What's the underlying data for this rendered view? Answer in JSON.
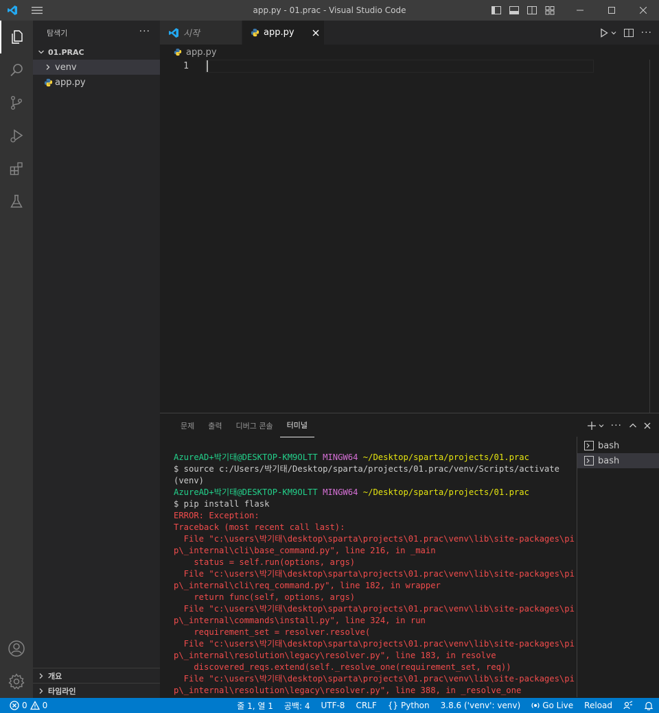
{
  "window": {
    "title": "app.py - 01.prac - Visual Studio Code"
  },
  "sidebar": {
    "header": "탐색기",
    "more": "···",
    "root_folder": "01.PRAC",
    "items": [
      {
        "label": "venv",
        "type": "folder"
      },
      {
        "label": "app.py",
        "type": "file"
      }
    ],
    "sections": [
      "개요",
      "타임라인"
    ]
  },
  "editor": {
    "tabs": [
      {
        "label": "시작",
        "active": false
      },
      {
        "label": "app.py",
        "active": true
      }
    ],
    "breadcrumb": "app.py",
    "line_number": "1"
  },
  "panel": {
    "tabs": [
      "문제",
      "출력",
      "디버그 콘솔",
      "터미널"
    ],
    "active_tab": "터미널",
    "terminals": [
      "bash",
      "bash"
    ],
    "lines": [
      [
        {
          "c": "t-green",
          "t": "AzureAD+박기태@DESKTOP-KM9OLTT "
        },
        {
          "c": "t-magenta",
          "t": "MINGW64 "
        },
        {
          "c": "t-yellow",
          "t": "~/Desktop/sparta/projects/01.prac"
        }
      ],
      [
        {
          "c": "t-white",
          "t": "$ source c:/Users/박기태/Desktop/sparta/projects/01.prac/venv/Scripts/activate"
        }
      ],
      [
        {
          "c": "t-white",
          "t": "(venv)"
        }
      ],
      [
        {
          "c": "t-green",
          "t": "AzureAD+박기태@DESKTOP-KM9OLTT "
        },
        {
          "c": "t-magenta",
          "t": "MINGW64 "
        },
        {
          "c": "t-yellow",
          "t": "~/Desktop/sparta/projects/01.prac"
        }
      ],
      [
        {
          "c": "t-white",
          "t": "$ pip install flask"
        }
      ],
      [
        {
          "c": "t-red",
          "t": "ERROR: Exception:"
        }
      ],
      [
        {
          "c": "t-red",
          "t": "Traceback (most recent call last):"
        }
      ],
      [
        {
          "c": "t-red",
          "t": "  File \"c:\\users\\박기태\\desktop\\sparta\\projects\\01.prac\\venv\\lib\\site-packages\\pi"
        }
      ],
      [
        {
          "c": "t-red",
          "t": "p\\_internal\\cli\\base_command.py\", line 216, in _main"
        }
      ],
      [
        {
          "c": "t-red",
          "t": "    status = self.run(options, args)"
        }
      ],
      [
        {
          "c": "t-red",
          "t": "  File \"c:\\users\\박기태\\desktop\\sparta\\projects\\01.prac\\venv\\lib\\site-packages\\pi"
        }
      ],
      [
        {
          "c": "t-red",
          "t": "p\\_internal\\cli\\req_command.py\", line 182, in wrapper"
        }
      ],
      [
        {
          "c": "t-red",
          "t": "    return func(self, options, args)"
        }
      ],
      [
        {
          "c": "t-red",
          "t": "  File \"c:\\users\\박기태\\desktop\\sparta\\projects\\01.prac\\venv\\lib\\site-packages\\pi"
        }
      ],
      [
        {
          "c": "t-red",
          "t": "p\\_internal\\commands\\install.py\", line 324, in run"
        }
      ],
      [
        {
          "c": "t-red",
          "t": "    requirement_set = resolver.resolve("
        }
      ],
      [
        {
          "c": "t-red",
          "t": "  File \"c:\\users\\박기태\\desktop\\sparta\\projects\\01.prac\\venv\\lib\\site-packages\\pi"
        }
      ],
      [
        {
          "c": "t-red",
          "t": "p\\_internal\\resolution\\legacy\\resolver.py\", line 183, in resolve"
        }
      ],
      [
        {
          "c": "t-red",
          "t": "    discovered_reqs.extend(self._resolve_one(requirement_set, req))"
        }
      ],
      [
        {
          "c": "t-red",
          "t": "  File \"c:\\users\\박기태\\desktop\\sparta\\projects\\01.prac\\venv\\lib\\site-packages\\pi"
        }
      ],
      [
        {
          "c": "t-red",
          "t": "p\\_internal\\resolution\\legacy\\resolver.py\", line 388, in _resolve_one"
        }
      ]
    ]
  },
  "statusbar": {
    "errors": "0",
    "warnings": "0",
    "position": "줄 1, 열 1",
    "spaces": "공백: 4",
    "encoding": "UTF-8",
    "eol": "CRLF",
    "language": "Python",
    "interpreter": "3.8.6 ('venv': venv)",
    "golive": "Go Live",
    "reload": "Reload"
  },
  "colors": {
    "accent": "#007acc",
    "terminal_error": "#f14c4c",
    "terminal_user": "#23d18b",
    "terminal_path": "#e5e510"
  }
}
